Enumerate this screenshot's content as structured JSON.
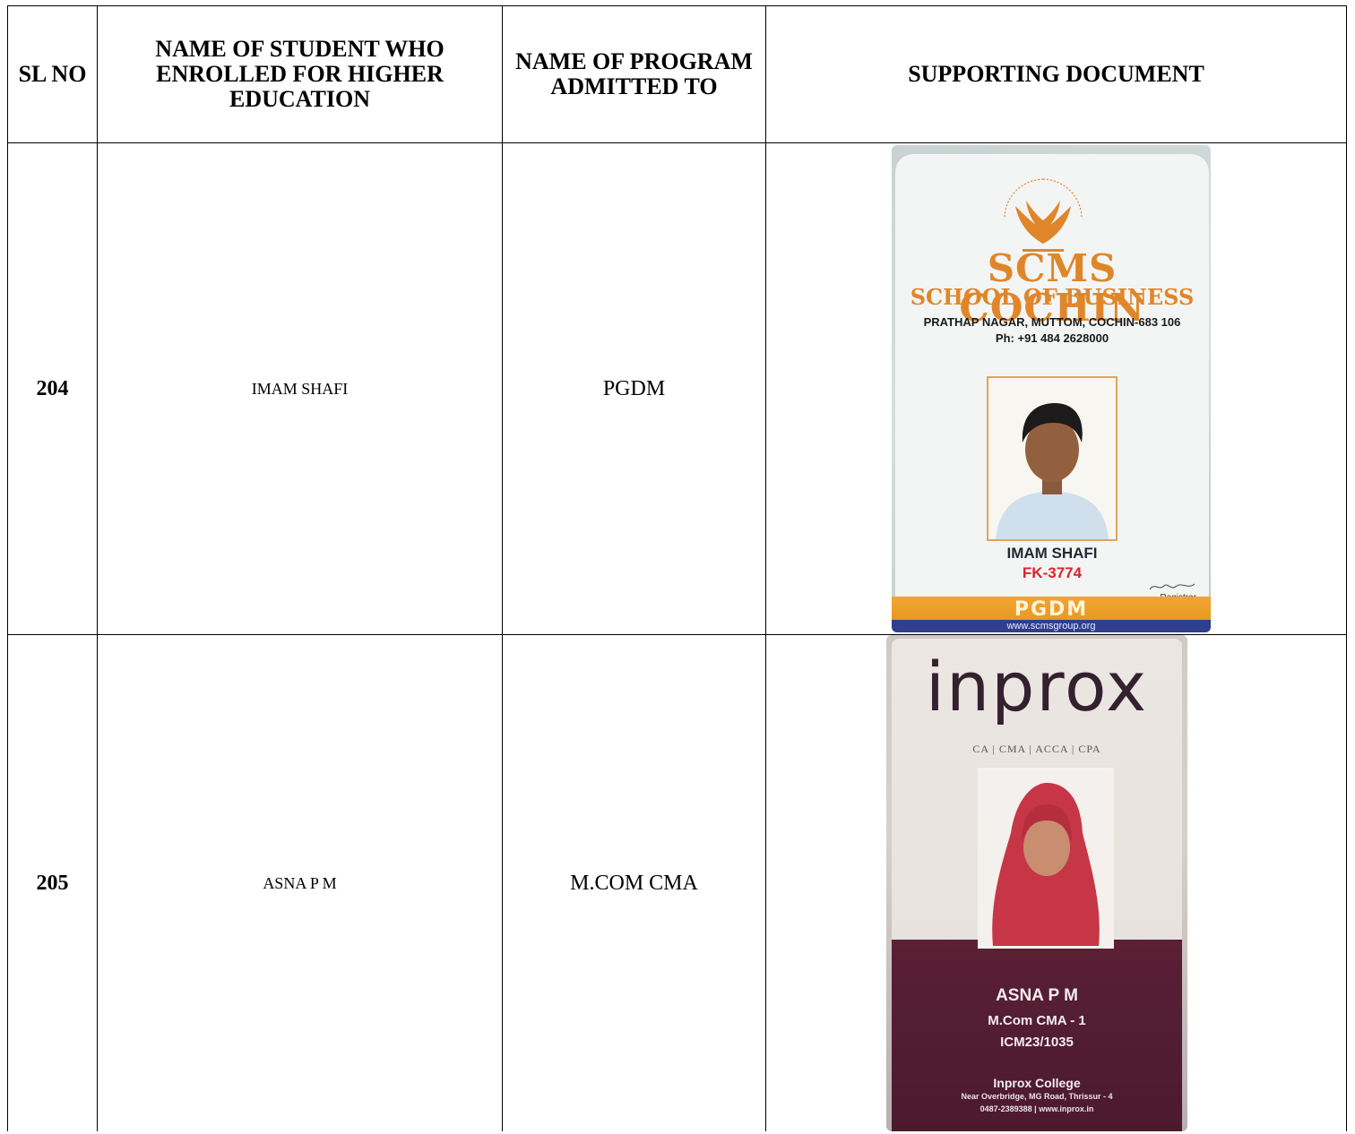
{
  "table": {
    "headers": {
      "sl_no": "SL NO",
      "student_name": "NAME OF STUDENT WHO ENROLLED FOR HIGHER EDUCATION",
      "program": "NAME OF PROGRAM ADMITTED TO",
      "document": "SUPPORTING DOCUMENT"
    },
    "rows": [
      {
        "sl_no": "204",
        "student_name": "IMAM SHAFI",
        "program": "PGDM",
        "id_card": {
          "institution_line1": "SCMS COCHIN",
          "institution_line2": "SCHOOL OF BUSINESS",
          "address": "PRATHAP NAGAR, MUTTOM, COCHIN-683 106",
          "phone": "Ph: +91 484 2628000",
          "holder_name": "IMAM SHAFI",
          "holder_id": "FK-3774",
          "signatory": "Registrar",
          "program_band": "PGDM",
          "website": "www.scmsgroup.org",
          "accent_color": "#e0862a"
        }
      },
      {
        "sl_no": "205",
        "student_name": "ASNA P M",
        "program": "M.COM CMA",
        "id_card": {
          "logo": "inprox",
          "tagline": "CA | CMA | ACCA | CPA",
          "holder_name": "ASNA P M",
          "course": "M.Com CMA - 1",
          "holder_id": "ICM23/1035",
          "college": "Inprox College",
          "address": "Near Overbridge, MG Road, Thrissur - 4",
          "contact": "0487-2389388 | www.inprox.in",
          "accent_color": "#4c1a2d"
        }
      }
    ]
  }
}
